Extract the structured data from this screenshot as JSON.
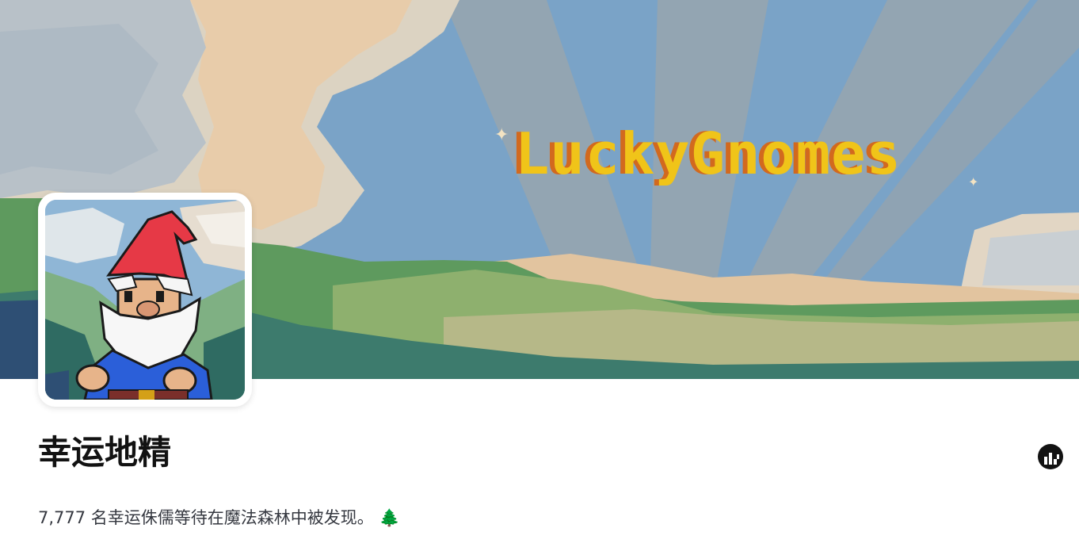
{
  "banner": {
    "title": "LuckyGnomes",
    "sparkle_glyph": "✦"
  },
  "collection": {
    "name": "幸运地精",
    "description": "7,777 名幸运侏儒等待在魔法森林中被发现。",
    "description_emoji": "🌲"
  },
  "icons": {
    "stats": "bar-chart-icon",
    "tree": "evergreen-tree-icon"
  },
  "colors": {
    "sky": "#7aa3c7",
    "cloud": "#d9c9b0",
    "hills": "#5e9a5e",
    "title_yellow": "#f0c419",
    "title_shadow": "#d2691e",
    "text_dark": "#121212",
    "text_body": "#353840"
  }
}
